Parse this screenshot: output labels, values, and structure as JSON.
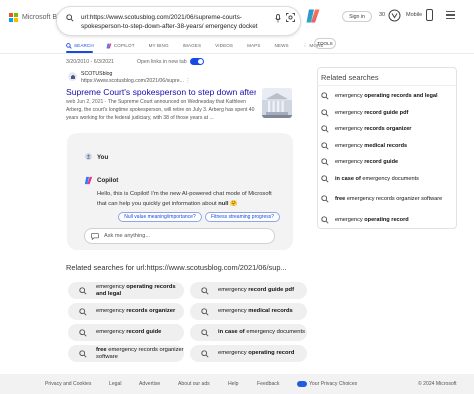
{
  "header": {
    "logo_text": "Microsoft Bing",
    "search_value": "url:https://www.scotusblog.com/2021/06/supreme-courts-spokesperson-to-step-down-after-38-years/ emergency docket",
    "signin_label": "Sign in",
    "points": "30",
    "mobile_label": "Mobile",
    "icons": [
      "search-icon",
      "microphone-icon",
      "visual-search-icon",
      "copilot-icon",
      "rewards-icon",
      "phone-icon",
      "hamburger-menu-icon"
    ]
  },
  "nav": {
    "tabs": [
      {
        "label": "SEARCH",
        "active": true
      },
      {
        "label": "COPILOT"
      },
      {
        "label": "MY BING"
      },
      {
        "label": "IMAGES"
      },
      {
        "label": "VIDEOS"
      },
      {
        "label": "MAPS"
      },
      {
        "label": "NEWS"
      },
      {
        "label": "MORE"
      }
    ],
    "tools_label": "TOOLS"
  },
  "filters": {
    "date_range": "3/20/2010 - 6/3/2021",
    "open_new_tab_label": "Open links in new tab",
    "open_new_tab_on": true
  },
  "result": {
    "site_name": "SCOTUSblog",
    "url": "https://www.scotusblog.com/2021/06/supre...",
    "title": "Supreme Court's spokesperson to step down after 38 ...",
    "snippet_date": "Jun 2, 2021",
    "snippet": "The Supreme Court announced on Wednesday that Kathleen Arberg, the court's longtime spokesperson, will retire on July 3. Arberg has spent 40 years working for the federal judiciary, with 38 of those years at ..."
  },
  "copilot": {
    "user_label": "You",
    "bot_label": "Copilot",
    "message_prefix": "Hello, this is Copilot! I'm the new AI-powered chat mode of Microsoft that can help you quickly get information about",
    "message_bold": "null",
    "message_emoji": "🤗",
    "chips": [
      "Null value meaning/importance?",
      "Fitness streaming progress?"
    ],
    "ask_placeholder": "Ask me anything..."
  },
  "related_bottom": {
    "heading": "Related searches for url:https://www.scotusblog.com/2021/06/sup...",
    "items": [
      {
        "pre": "emergency ",
        "bold": "operating records and legal",
        "post": ""
      },
      {
        "pre": "emergency ",
        "bold": "record guide pdf",
        "post": ""
      },
      {
        "pre": "emergency ",
        "bold": "records organizer",
        "post": ""
      },
      {
        "pre": "emergency ",
        "bold": "medical records",
        "post": ""
      },
      {
        "pre": "emergency ",
        "bold": "record guide",
        "post": ""
      },
      {
        "pre": "",
        "bold": "in case of",
        "post": " emergency documents"
      },
      {
        "pre": "",
        "bold": "free",
        "post": " emergency records organizer software"
      },
      {
        "pre": "emergency ",
        "bold": "operating record",
        "post": ""
      }
    ]
  },
  "related_panel": {
    "heading": "Related searches",
    "items": [
      {
        "pre": "emergency ",
        "bold": "operating records and legal",
        "post": ""
      },
      {
        "pre": "emergency ",
        "bold": "record guide pdf",
        "post": ""
      },
      {
        "pre": "emergency ",
        "bold": "records organizer",
        "post": ""
      },
      {
        "pre": "emergency ",
        "bold": "medical records",
        "post": ""
      },
      {
        "pre": "emergency ",
        "bold": "record guide",
        "post": ""
      },
      {
        "pre": "",
        "bold": "in case of",
        "post": " emergency documents"
      },
      {
        "pre": "",
        "bold": "free",
        "post": " emergency records organizer software"
      },
      {
        "pre": "emergency ",
        "bold": "operating record",
        "post": ""
      }
    ]
  },
  "footer": {
    "links": [
      "Privacy and Cookies",
      "Legal",
      "Advertise",
      "About our ads",
      "Help",
      "Feedback",
      "Your Privacy Choices"
    ],
    "copyright": "© 2024 Microsoft"
  },
  "colors": {
    "accent": "#174ae4",
    "link_title": "#1a0dab",
    "logo": [
      "#f25022",
      "#7fba00",
      "#00a4ef",
      "#ffb900"
    ]
  }
}
